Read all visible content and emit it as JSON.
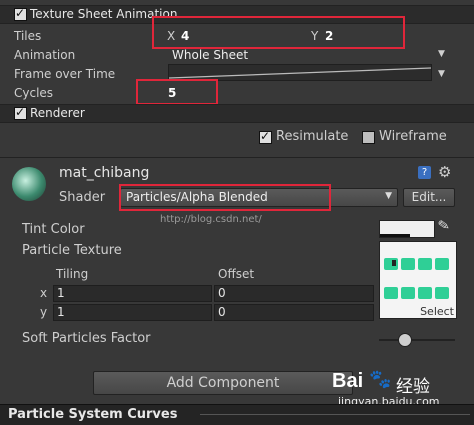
{
  "texture_sheet": {
    "title": "Texture Sheet Animation",
    "tiles_label": "Tiles",
    "tiles_x_label": "X",
    "tiles_x_value": "4",
    "tiles_y_label": "Y",
    "tiles_y_value": "2",
    "animation_label": "Animation",
    "animation_value": "Whole Sheet",
    "frame_over_time_label": "Frame over Time",
    "cycles_label": "Cycles",
    "cycles_value": "5"
  },
  "renderer": {
    "title": "Renderer"
  },
  "options": {
    "resimulate_label": "Resimulate",
    "resimulate_checked": true,
    "wireframe_label": "Wireframe",
    "wireframe_checked": false
  },
  "material": {
    "name": "mat_chibang",
    "shader_label": "Shader",
    "shader_value": "Particles/Alpha Blended",
    "edit_label": "Edit...",
    "watermark": "http://blog.csdn.net/",
    "tint_color_label": "Tint Color",
    "particle_texture_label": "Particle Texture",
    "tiling_label": "Tiling",
    "offset_label": "Offset",
    "x_label": "x",
    "y_label": "y",
    "tiling_x": "1",
    "tiling_y": "1",
    "offset_x": "0",
    "offset_y": "0",
    "select_label": "Select",
    "soft_particles_label": "Soft Particles Factor"
  },
  "add_component_label": "Add Component",
  "curves_title": "Particle System Curves",
  "baidu": {
    "brand": "Bai",
    "brand2": "经验",
    "url": "jingyan.baidu.com"
  },
  "colors": {
    "highlight": "#e0263a",
    "panel": "#383838",
    "header": "#2b2b2b"
  }
}
